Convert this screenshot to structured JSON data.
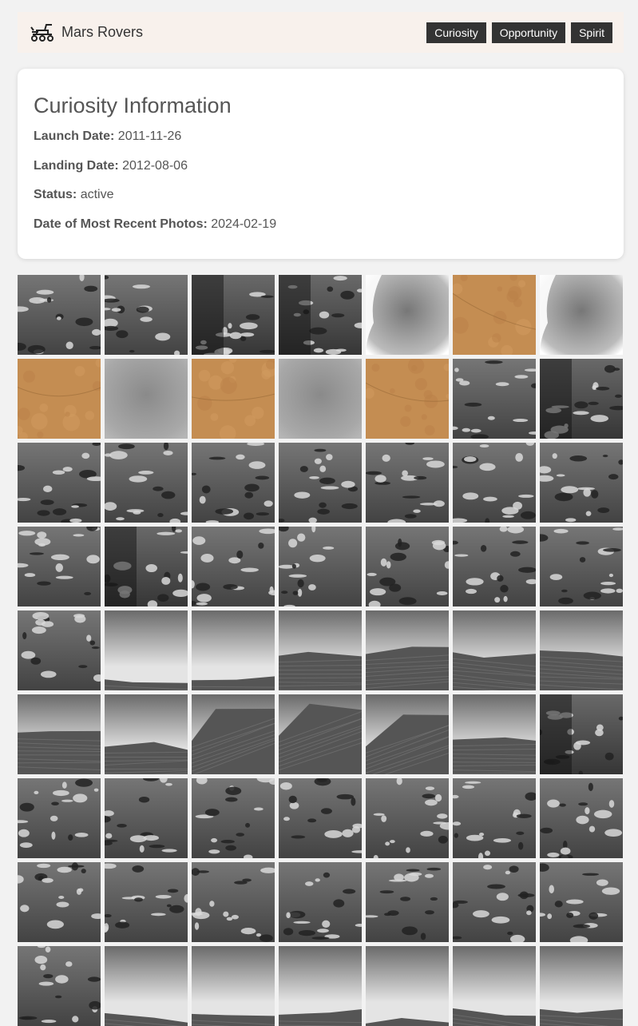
{
  "nav": {
    "brand": "Mars Rovers",
    "logo_icon": "rover-icon",
    "buttons": [
      "Curiosity",
      "Opportunity",
      "Spirit"
    ]
  },
  "info": {
    "title": "Curiosity Information",
    "rows": [
      {
        "label": "Launch Date:",
        "value": "2011-11-26"
      },
      {
        "label": "Landing Date:",
        "value": "2012-08-06"
      },
      {
        "label": "Status:",
        "value": "active"
      },
      {
        "label": "Date of Most Recent Photos:",
        "value": "2024-02-19"
      }
    ]
  },
  "photo_styles": [
    "rocks",
    "rocks",
    "rocks-dark",
    "rocks-dark",
    "cloud",
    "sand",
    "cloud",
    "sand",
    "haze",
    "sand",
    "haze",
    "sand",
    "rocks",
    "rocks-dark",
    "rocks",
    "rocks",
    "rocks",
    "rocks",
    "rocks",
    "rocks",
    "rocks",
    "rocks",
    "rocks-dark",
    "rocks",
    "rocks",
    "rocks",
    "rocks",
    "rocks",
    "rocks",
    "sky",
    "sky",
    "horizon",
    "horizon",
    "horizon",
    "horizon",
    "horizon",
    "horizon",
    "slope",
    "slope",
    "slope",
    "horizon",
    "rocks-dark",
    "rocks",
    "rocks",
    "rocks",
    "rocks",
    "rocks",
    "rocks",
    "rocks",
    "rocks",
    "rocks",
    "rocks",
    "rocks",
    "rocks",
    "rocks",
    "rocks",
    "rocks",
    "sky",
    "sky",
    "sky",
    "sky",
    "sky",
    "sky"
  ],
  "colors": {
    "navbar_bg": "#f8f1ec",
    "button_bg": "#333333",
    "sand": "#c8904f"
  }
}
